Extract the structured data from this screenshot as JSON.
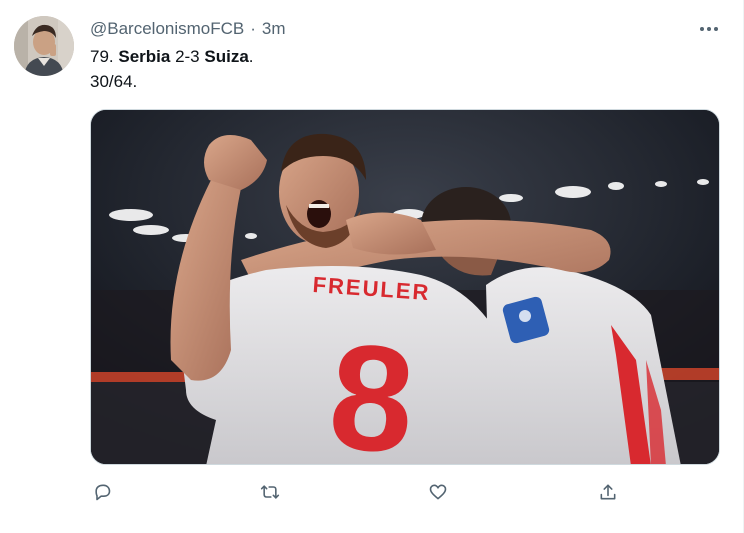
{
  "tweet": {
    "handle": "@BarcelonismoFCB",
    "separator": "·",
    "time": "3m",
    "text": {
      "prefix": "79. ",
      "team1": "Serbia",
      "score": " 2-3 ",
      "team2": "Suiza",
      "suffix": ".",
      "line2": "30/64."
    },
    "media": {
      "jersey_name": "FREULER",
      "jersey_number": "8"
    },
    "actions": {
      "reply_icon": "reply-icon",
      "retweet_icon": "retweet-icon",
      "like_icon": "heart-icon",
      "share_icon": "share-icon"
    }
  },
  "colors": {
    "text_primary": "#0f1419",
    "text_secondary": "#536471",
    "border": "#cfd9de",
    "jersey_red": "#d8292f"
  }
}
